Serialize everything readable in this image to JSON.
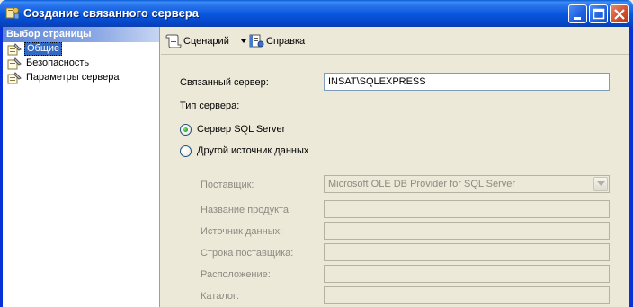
{
  "window": {
    "title": "Создание связанного сервера",
    "controls": [
      "minimize-icon",
      "maximize-icon",
      "close-icon"
    ]
  },
  "nav": {
    "header": "Выбор страницы",
    "items": [
      {
        "label": "Общие",
        "selected": true,
        "icon": "page-wrench-icon"
      },
      {
        "label": "Безопасность",
        "selected": false,
        "icon": "page-wrench-icon"
      },
      {
        "label": "Параметры сервера",
        "selected": false,
        "icon": "page-wrench-icon"
      }
    ]
  },
  "toolbar": {
    "script_label": "Сценарий",
    "help_label": "Справка"
  },
  "form": {
    "linked_server_label": "Связанный сервер:",
    "linked_server_value": "INSAT\\SQLEXPRESS",
    "server_type_label": "Тип сервера:",
    "radio_sql_server": "Сервер SQL Server",
    "radio_other_source": "Другой источник данных",
    "selected_server_type": "Сервер SQL Server",
    "provider_label": "Поставщик:",
    "provider_value": "Microsoft OLE DB Provider for SQL Server",
    "product_name_label": "Название продукта:",
    "data_source_label": "Источник данных:",
    "provider_string_label": "Строка поставщика:",
    "location_label": "Расположение:",
    "catalog_label": "Каталог:"
  },
  "colors": {
    "titlebar": "#0855dd",
    "panel_bg": "#ece9d8",
    "selection": "#316ac5"
  }
}
